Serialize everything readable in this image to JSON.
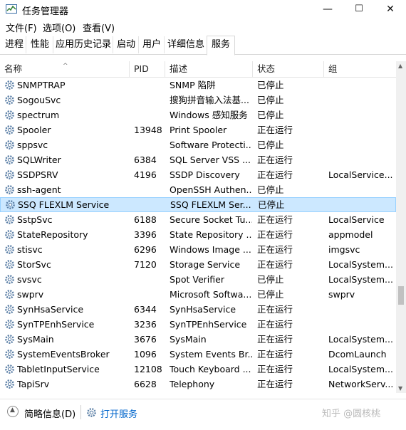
{
  "window": {
    "title": "任务管理器",
    "minimize": "—",
    "maximize": "☐",
    "close": "✕"
  },
  "menu": [
    "文件(F)",
    "选项(O)",
    "查看(V)"
  ],
  "tabs": [
    "进程",
    "性能",
    "应用历史记录",
    "启动",
    "用户",
    "详细信息",
    "服务"
  ],
  "active_tab": "服务",
  "columns": {
    "name": "名称",
    "pid": "PID",
    "desc": "描述",
    "status": "状态",
    "group": "组"
  },
  "sort_arrow": "^",
  "services": [
    {
      "name": "SNMPTRAP",
      "pid": "",
      "desc": "SNMP 陷阱",
      "status": "已停止",
      "group": ""
    },
    {
      "name": "SogouSvc",
      "pid": "",
      "desc": "搜狗拼音输入法基...",
      "status": "已停止",
      "group": ""
    },
    {
      "name": "spectrum",
      "pid": "",
      "desc": "Windows 感知服务",
      "status": "已停止",
      "group": ""
    },
    {
      "name": "Spooler",
      "pid": "13948",
      "desc": "Print Spooler",
      "status": "正在运行",
      "group": ""
    },
    {
      "name": "sppsvc",
      "pid": "",
      "desc": "Software Protecti...",
      "status": "已停止",
      "group": ""
    },
    {
      "name": "SQLWriter",
      "pid": "6384",
      "desc": "SQL Server VSS ...",
      "status": "正在运行",
      "group": ""
    },
    {
      "name": "SSDPSRV",
      "pid": "4196",
      "desc": "SSDP Discovery",
      "status": "正在运行",
      "group": "LocalService..."
    },
    {
      "name": "ssh-agent",
      "pid": "",
      "desc": "OpenSSH Authen...",
      "status": "已停止",
      "group": ""
    },
    {
      "name": "SSQ FLEXLM Service",
      "pid": "",
      "desc": "SSQ FLEXLM Ser...",
      "status": "已停止",
      "group": "",
      "selected": true
    },
    {
      "name": "SstpSvc",
      "pid": "6188",
      "desc": "Secure Socket Tu...",
      "status": "正在运行",
      "group": "LocalService"
    },
    {
      "name": "StateRepository",
      "pid": "3396",
      "desc": "State Repository ...",
      "status": "正在运行",
      "group": "appmodel"
    },
    {
      "name": "stisvc",
      "pid": "6296",
      "desc": "Windows Image ...",
      "status": "正在运行",
      "group": "imgsvc"
    },
    {
      "name": "StorSvc",
      "pid": "7120",
      "desc": "Storage Service",
      "status": "正在运行",
      "group": "LocalSystem..."
    },
    {
      "name": "svsvc",
      "pid": "",
      "desc": "Spot Verifier",
      "status": "已停止",
      "group": "LocalSystem..."
    },
    {
      "name": "swprv",
      "pid": "",
      "desc": "Microsoft Softwa...",
      "status": "已停止",
      "group": "swprv"
    },
    {
      "name": "SynHsaService",
      "pid": "6344",
      "desc": "SynHsaService",
      "status": "正在运行",
      "group": ""
    },
    {
      "name": "SynTPEnhService",
      "pid": "3236",
      "desc": "SynTPEnhService",
      "status": "正在运行",
      "group": ""
    },
    {
      "name": "SysMain",
      "pid": "3676",
      "desc": "SysMain",
      "status": "正在运行",
      "group": "LocalSystem..."
    },
    {
      "name": "SystemEventsBroker",
      "pid": "1096",
      "desc": "System Events Br...",
      "status": "正在运行",
      "group": "DcomLaunch"
    },
    {
      "name": "TabletInputService",
      "pid": "12108",
      "desc": "Touch Keyboard ...",
      "status": "正在运行",
      "group": "LocalSystem..."
    },
    {
      "name": "TapiSrv",
      "pid": "6628",
      "desc": "Telephony",
      "status": "正在运行",
      "group": "NetworkServ..."
    }
  ],
  "footer": {
    "collapse_label": "简略信息(D)",
    "open_services": "打开服务",
    "watermark": "知乎 @圆核桃"
  },
  "colors": {
    "selected_bg": "#cce8ff",
    "selected_border": "#99d1ff",
    "link": "#0066cc",
    "gear": "#5b7fa6"
  }
}
